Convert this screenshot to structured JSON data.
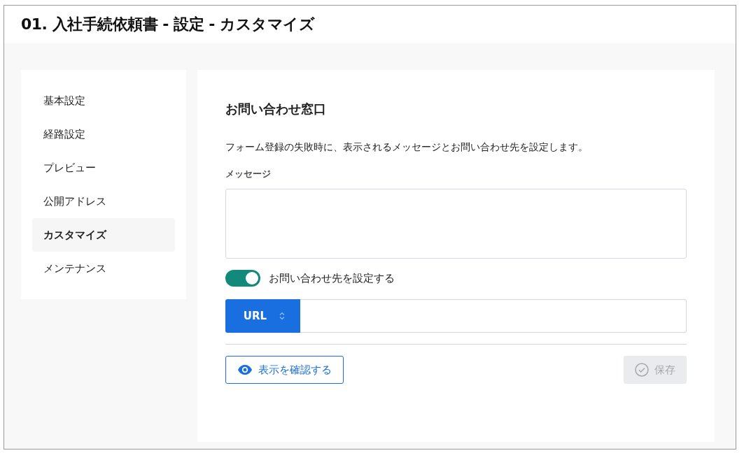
{
  "title": "01. 入社手続依頼書 - 設定 - カスタマイズ",
  "sidebar": {
    "items": [
      {
        "label": "基本設定",
        "selected": false
      },
      {
        "label": "経路設定",
        "selected": false
      },
      {
        "label": "プレビュー",
        "selected": false
      },
      {
        "label": "公開アドレス",
        "selected": false
      },
      {
        "label": "カスタマイズ",
        "selected": true
      },
      {
        "label": "メンテナンス",
        "selected": false
      }
    ]
  },
  "section": {
    "heading": "お問い合わせ窓口",
    "description": "フォーム登録の失敗時に、表示されるメッセージとお問い合わせ先を設定します。",
    "message_label": "メッセージ",
    "contact_toggle": {
      "label": "お問い合わせ先を設定する",
      "on": true
    },
    "contact_type": "URL",
    "preview_button": "表示を確認する",
    "save_button": {
      "label": "保存",
      "disabled": true
    }
  }
}
